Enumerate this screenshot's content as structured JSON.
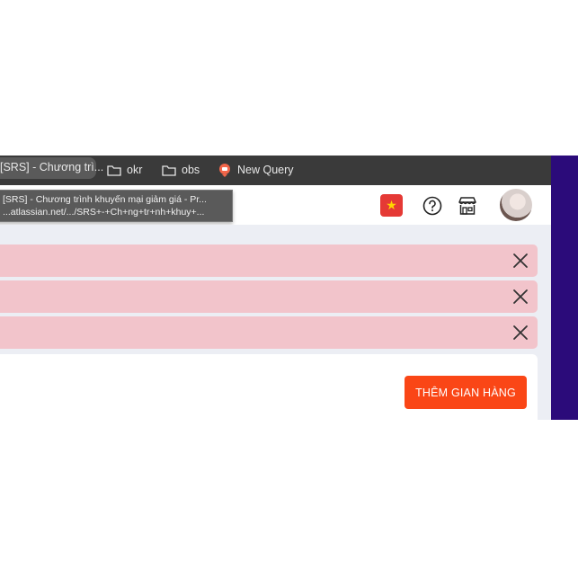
{
  "bookmarks_bar": {
    "active_tab_label": "[SRS] - Chương trì...",
    "items": [
      {
        "label": "okr",
        "icon": "folder-icon"
      },
      {
        "label": "obs",
        "icon": "folder-icon"
      },
      {
        "label": "New Query",
        "icon": "query-icon"
      }
    ]
  },
  "tooltip": {
    "title": "[SRS] - Chương trình khuyến mại giảm giá - Pr...",
    "url": "...atlassian.net/.../SRS+-+Ch+ng+tr+nh+khuy+..."
  },
  "header": {
    "flag_icon": "vietnam-flag-icon",
    "help_icon": "help-circle-icon",
    "store_icon": "store-icon",
    "avatar": "user-avatar"
  },
  "alerts": [
    {
      "close_icon": "close-icon"
    },
    {
      "close_icon": "close-icon"
    },
    {
      "close_icon": "close-icon"
    }
  ],
  "main": {
    "add_store_label": "THÊM GIAN HÀNG"
  },
  "colors": {
    "accent": "#fa4616",
    "alert_bg": "#f2c4cb",
    "sidebar": "#2b0b7a",
    "flag_red": "#e53935"
  }
}
